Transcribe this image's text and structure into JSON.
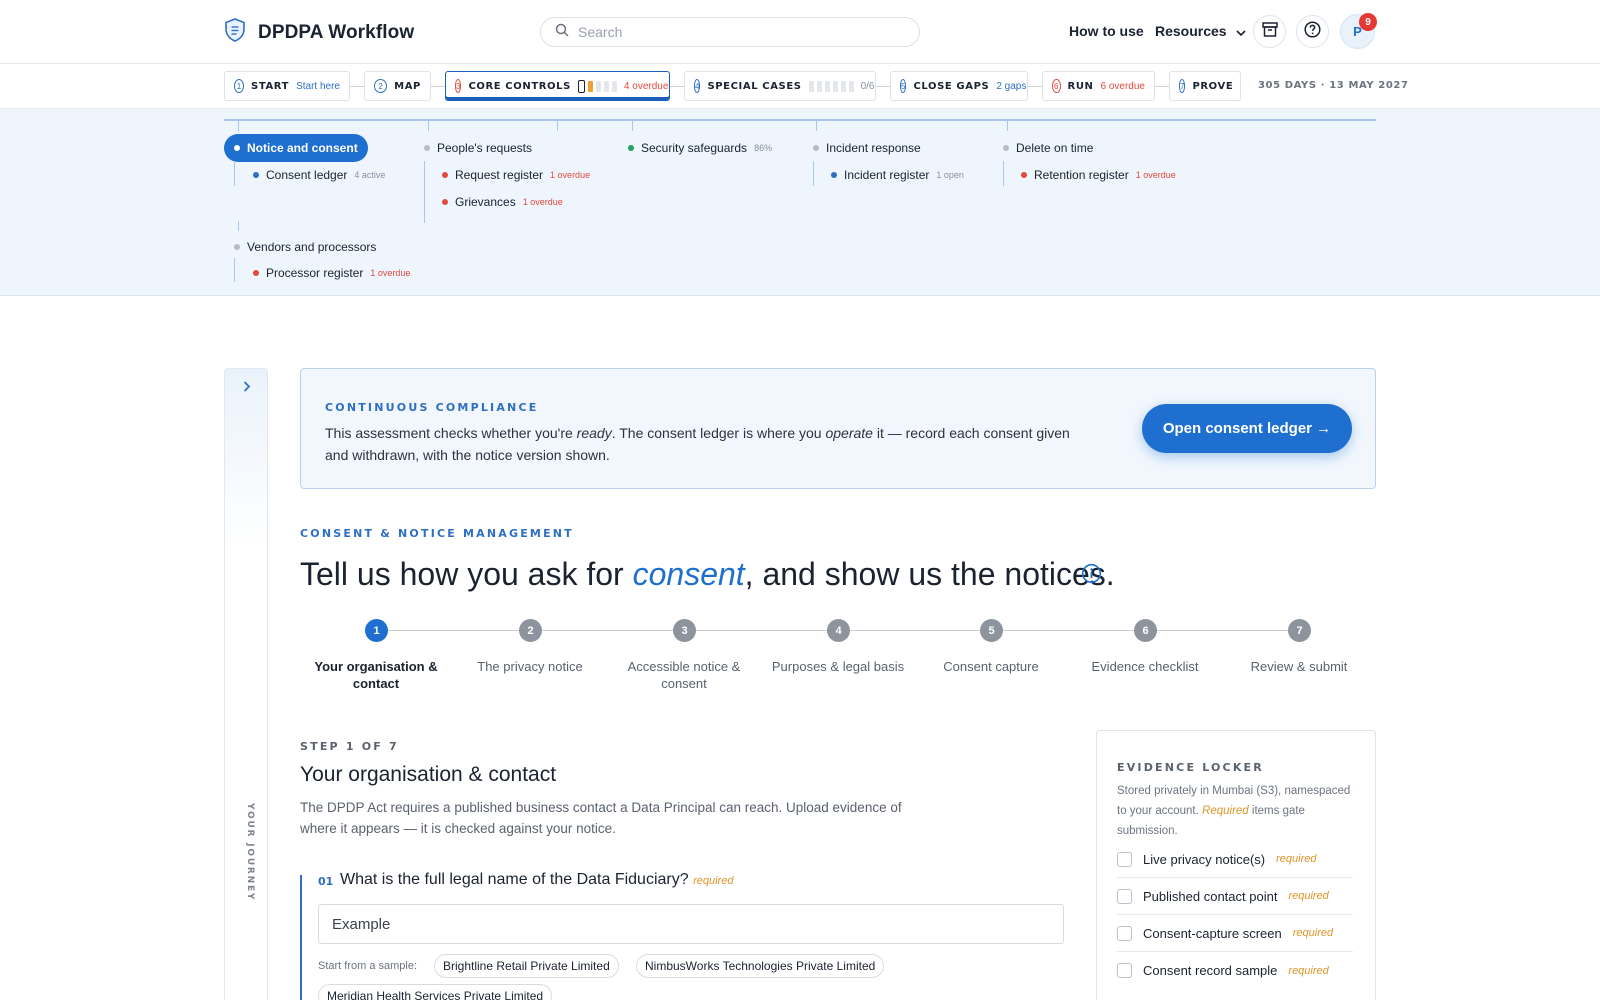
{
  "header": {
    "app_title": "DPDPA Workflow",
    "search_placeholder": "Search",
    "how_to_use": "How to use",
    "resources": "Resources",
    "avatar_initial": "P",
    "notification_count": "9"
  },
  "stages": [
    {
      "num": "1",
      "name": "START",
      "sub": "Start here"
    },
    {
      "num": "2",
      "name": "MAP",
      "sub": ""
    },
    {
      "num": "3",
      "name": "CORE CONTROLS",
      "sub": "4 overdue",
      "active": true
    },
    {
      "num": "4",
      "name": "SPECIAL CASES",
      "sub": "0/6"
    },
    {
      "num": "5",
      "name": "CLOSE GAPS",
      "sub": "2 gaps"
    },
    {
      "num": "6",
      "name": "RUN",
      "sub": "6 overdue"
    },
    {
      "num": "7",
      "name": "PROVE",
      "sub": ""
    }
  ],
  "deadline": "305 DAYS · 13 MAY 2027",
  "journey": {
    "nodes": [
      {
        "label": "Notice and consent",
        "active": true
      },
      {
        "label": "People's requests"
      },
      {
        "label": "Security safeguards",
        "note": "86%"
      },
      {
        "label": "Incident response"
      },
      {
        "label": "Delete on time"
      },
      {
        "label": "Vendors and processors"
      }
    ],
    "subs": [
      {
        "label": "Consent ledger",
        "note": "4 active"
      },
      {
        "label": "Request register",
        "note": "1 overdue"
      },
      {
        "label": "Grievances",
        "note": "1 overdue"
      },
      {
        "label": "Incident register",
        "note": "1 open"
      },
      {
        "label": "Retention register",
        "note": "1 overdue"
      },
      {
        "label": "Processor register",
        "note": "1 overdue"
      }
    ]
  },
  "rail": {
    "label": "YOUR JOURNEY"
  },
  "callout": {
    "eyebrow": "CONTINUOUS COMPLIANCE",
    "text_1": "This assessment checks whether you're ",
    "text_em1": "ready",
    "text_2": ". The consent ledger is where you ",
    "text_em2": "operate",
    "text_3": " it — record each consent given and withdrawn, with the notice version shown.",
    "button": "Open consent ledger →"
  },
  "section": {
    "eyebrow": "CONSENT & NOTICE MANAGEMENT",
    "title_pre": "Tell us how you ask for ",
    "title_hl": "consent",
    "title_post": ", and show us the notices."
  },
  "steps": [
    {
      "num": "1",
      "label": "Your organisation & contact"
    },
    {
      "num": "2",
      "label": "The privacy notice"
    },
    {
      "num": "3",
      "label": "Accessible notice & consent"
    },
    {
      "num": "4",
      "label": "Purposes & legal basis"
    },
    {
      "num": "5",
      "label": "Consent capture"
    },
    {
      "num": "6",
      "label": "Evidence checklist"
    },
    {
      "num": "7",
      "label": "Review & submit"
    }
  ],
  "form": {
    "eyebrow": "STEP 1 OF 7",
    "title": "Your organisation & contact",
    "description": "The DPDP Act requires a published business contact a Data Principal can reach. Upload evidence of where it appears — it is checked against your notice.",
    "question_num": "01",
    "question": "What is the full legal name of the Data Fiduciary?",
    "required": "required",
    "input_placeholder": "Example",
    "sample_label": "Start from a sample:",
    "samples": [
      "Brightline Retail Private Limited",
      "NimbusWorks Technologies Private Limited",
      "Meridian Health Services Private Limited"
    ]
  },
  "locker": {
    "eyebrow": "EVIDENCE LOCKER",
    "desc_1": "Stored privately in Mumbai (S3), namespaced to your account. ",
    "desc_em": "Required",
    "desc_2": " items gate submission.",
    "items": [
      {
        "label": "Live privacy notice(s)",
        "tag": "required"
      },
      {
        "label": "Published contact point",
        "tag": "required"
      },
      {
        "label": "Consent-capture screen",
        "tag": "required"
      },
      {
        "label": "Consent record sample",
        "tag": "required"
      }
    ]
  },
  "colors": {
    "accent": "#1e6fd0",
    "danger": "#e14a3d",
    "warning": "#e0962a",
    "success": "#21a35b"
  }
}
